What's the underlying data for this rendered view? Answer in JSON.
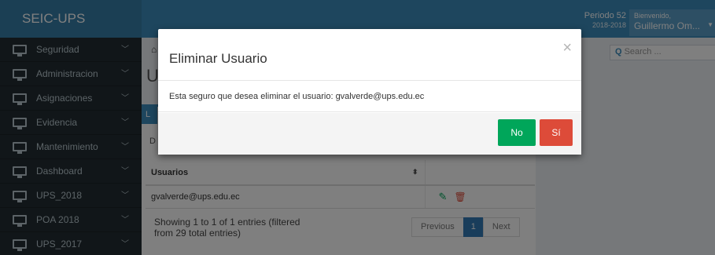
{
  "brand": "SEIC-UPS",
  "header": {
    "periodo_label": "Periodo 52",
    "periodo_years": "2018-2018",
    "welcome_label": "Bienvenido,",
    "user_name": "Guillermo Om..."
  },
  "sidebar": {
    "items": [
      {
        "label": "Seguridad"
      },
      {
        "label": "Administracion"
      },
      {
        "label": "Asignaciones"
      },
      {
        "label": "Evidencia"
      },
      {
        "label": "Mantenimiento"
      },
      {
        "label": "Dashboard"
      },
      {
        "label": "UPS_2018"
      },
      {
        "label": "POA 2018"
      },
      {
        "label": "UPS_2017"
      }
    ]
  },
  "content": {
    "search_placeholder": "Search ...",
    "page_title": "U",
    "box_tab_label": "L",
    "datatable_length_label": "D",
    "table": {
      "header": "Usuarios",
      "rows": [
        {
          "email": "gvalverde@ups.edu.ec"
        }
      ]
    },
    "info": "Showing 1 to 1 of 1 entries (filtered from 29 total entries)",
    "pagination": {
      "previous": "Previous",
      "current": "1",
      "next": "Next"
    }
  },
  "modal": {
    "title": "Eliminar Usuario",
    "close": "×",
    "message": "Esta seguro que desea eliminar el usuario: gvalverde@ups.edu.ec",
    "no_label": "No",
    "yes_label": "Sí"
  },
  "colors": {
    "navbar": "#3c8dbc",
    "sidebar": "#222d32",
    "no_button": "#00a65a",
    "yes_button": "#dd4b39"
  }
}
